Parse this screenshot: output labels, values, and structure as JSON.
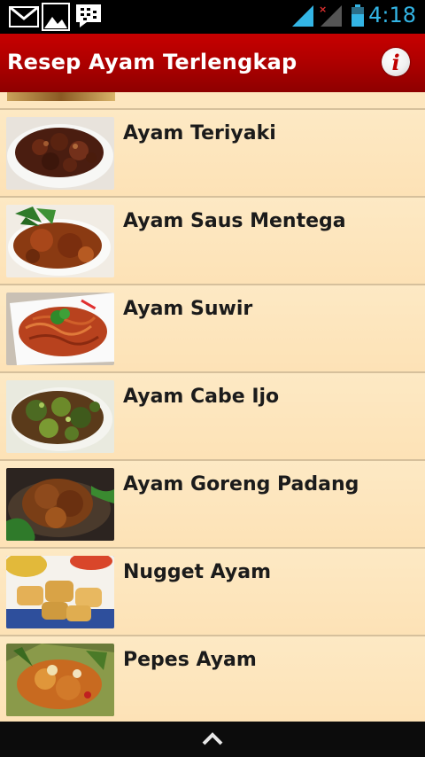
{
  "status_bar": {
    "time": "4:18",
    "icons": [
      "gmail-icon",
      "gallery-icon",
      "bbm-icon",
      "signal-icon",
      "signal-no-data-icon",
      "battery-icon"
    ]
  },
  "action_bar": {
    "title": "Resep Ayam Terlengkap",
    "info_icon": "info-icon",
    "info_glyph": "i"
  },
  "recipes": [
    {
      "name": "Ayam Teriyaki"
    },
    {
      "name": "Ayam Saus Mentega"
    },
    {
      "name": "Ayam Suwir"
    },
    {
      "name": "Ayam Cabe Ijo"
    },
    {
      "name": "Ayam Goreng Padang"
    },
    {
      "name": "Nugget Ayam"
    },
    {
      "name": "Pepes Ayam"
    }
  ],
  "colors": {
    "action_bar": "#b00000",
    "list_background": "#fde6bf",
    "status_time": "#33b5e5"
  },
  "nav_bar": {
    "icon": "chevron-up-icon"
  }
}
